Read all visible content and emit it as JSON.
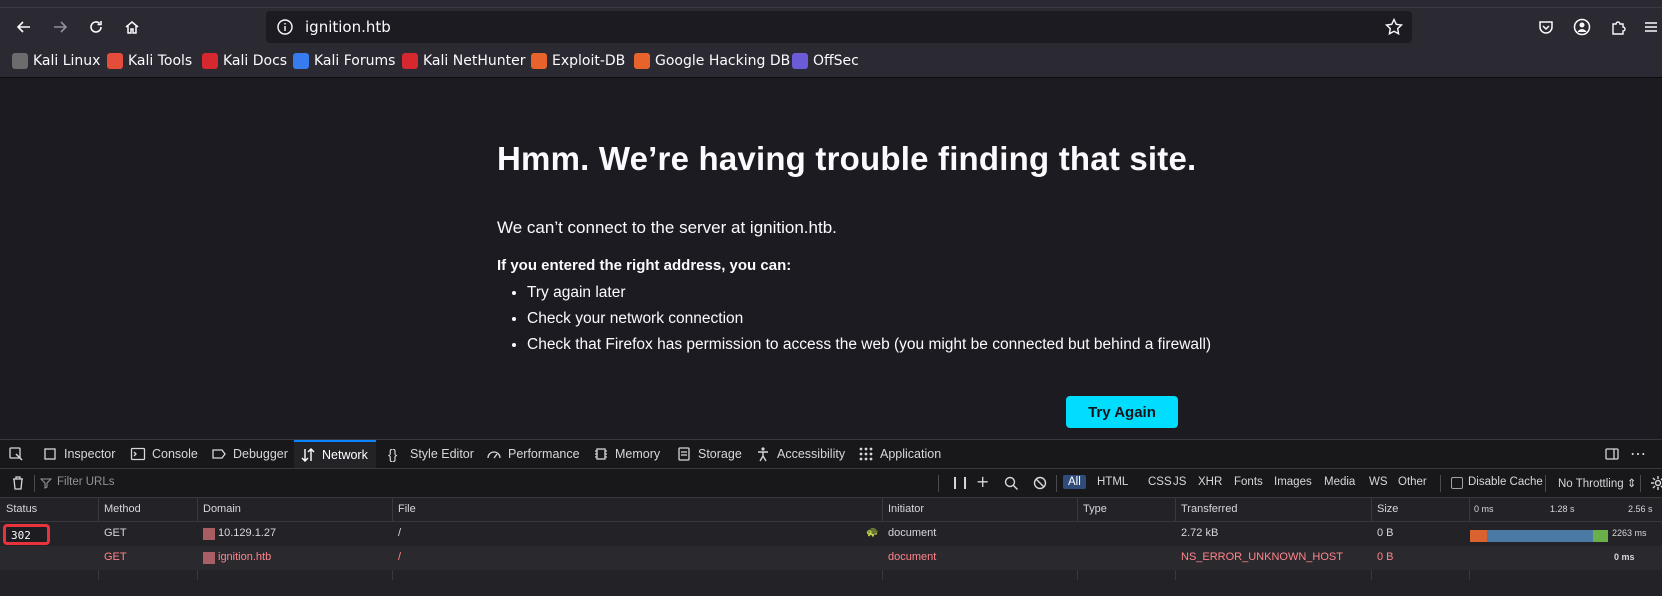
{
  "browser": {
    "url": "ignition.htb"
  },
  "bookmarks": [
    {
      "label": "Kali Linux",
      "color": "#6c6c6c"
    },
    {
      "label": "Kali Tools",
      "color": "#e44d3a"
    },
    {
      "label": "Kali Docs",
      "color": "#d7282f"
    },
    {
      "label": "Kali Forums",
      "color": "#367bf0"
    },
    {
      "label": "Kali NetHunter",
      "color": "#d7282f"
    },
    {
      "label": "Exploit-DB",
      "color": "#e8632b"
    },
    {
      "label": "Google Hacking DB",
      "color": "#e8632b"
    },
    {
      "label": "OffSec",
      "color": "#6b5bd6"
    }
  ],
  "error_page": {
    "title": "Hmm. We’re having trouble finding that site.",
    "description": "We can’t connect to the server at ignition.htb.",
    "subheading": "If you entered the right address, you can:",
    "suggestions": [
      "Try again later",
      "Check your network connection",
      "Check that Firefox has permission to access the web (you might be connected but behind a firewall)"
    ],
    "button_label": "Try Again"
  },
  "devtools": {
    "tabs": [
      "Inspector",
      "Console",
      "Debugger",
      "Network",
      "Style Editor",
      "Performance",
      "Memory",
      "Storage",
      "Accessibility",
      "Application"
    ],
    "active_tab": "Network",
    "filter_placeholder": "Filter URLs",
    "type_filters": [
      "All",
      "HTML",
      "CSS",
      "JS",
      "XHR",
      "Fonts",
      "Images",
      "Media",
      "WS",
      "Other"
    ],
    "disable_cache_label": "Disable Cache",
    "throttling_label": "No Throttling ⇕",
    "columns": [
      "Status",
      "Method",
      "Domain",
      "File",
      "Initiator",
      "Type",
      "Transferred",
      "Size"
    ],
    "waterfall_ticks": [
      "0 ms",
      "1.28 s",
      "2.56 s"
    ],
    "requests": [
      {
        "status": "302",
        "method": "GET",
        "domain": "10.129.1.27",
        "file": "/",
        "initiator": "document",
        "type": "",
        "transferred": "2.72 kB",
        "size": "0 B",
        "timing": "2263 ms"
      },
      {
        "status": "",
        "method": "GET",
        "domain": "ignition.htb",
        "file": "/",
        "initiator": "document",
        "type": "",
        "transferred": "NS_ERROR_UNKNOWN_HOST",
        "size": "0 B",
        "timing": "0 ms"
      }
    ]
  }
}
